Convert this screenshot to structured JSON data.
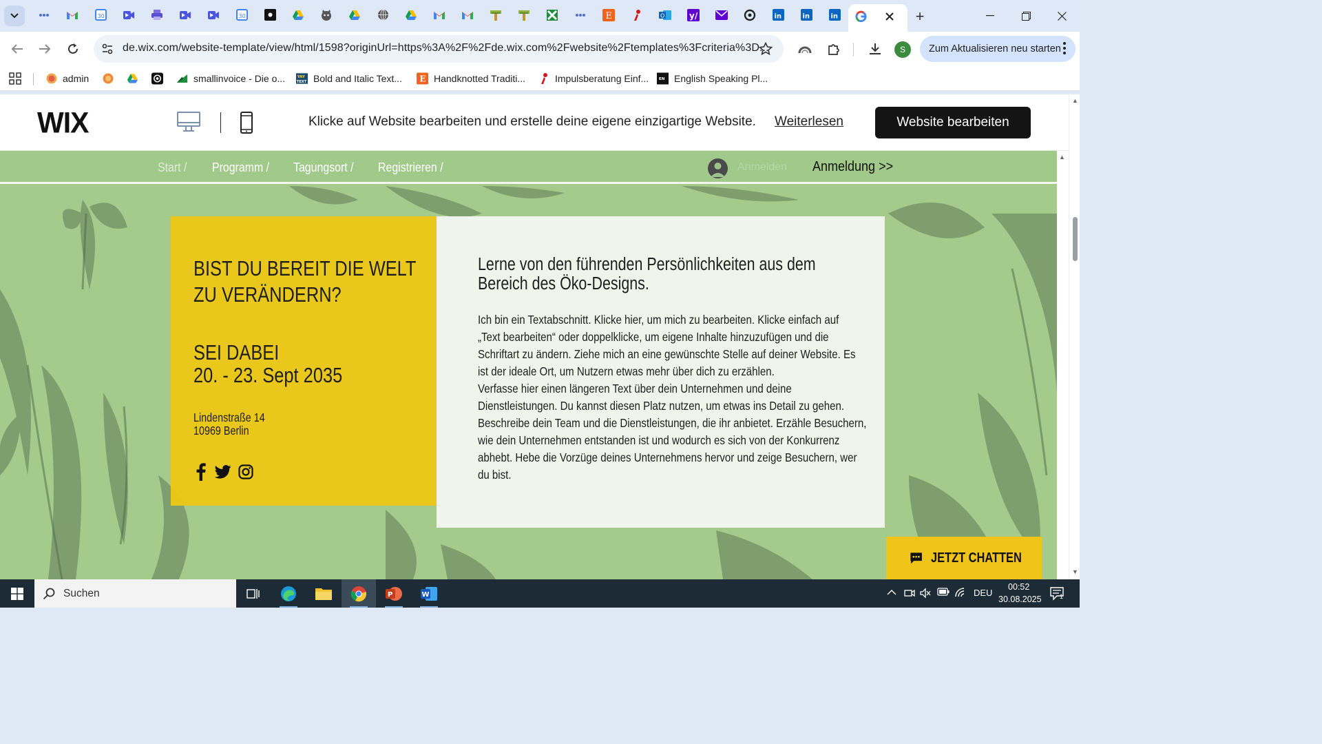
{
  "browser": {
    "tabs": [
      {
        "icon": "chat-tab-icon"
      },
      {
        "icon": "gmail-icon"
      },
      {
        "icon": "calendar-icon"
      },
      {
        "icon": "video-icon"
      },
      {
        "icon": "printer-icon"
      },
      {
        "icon": "video-icon"
      },
      {
        "icon": "video-icon"
      },
      {
        "icon": "calendar-icon"
      },
      {
        "icon": "notes-icon"
      },
      {
        "icon": "drive-icon"
      },
      {
        "icon": "cat-icon"
      },
      {
        "icon": "drive-icon"
      },
      {
        "icon": "globe-icon"
      },
      {
        "icon": "drive-icon"
      },
      {
        "icon": "gmail-icon"
      },
      {
        "icon": "gmail-icon"
      },
      {
        "icon": "tool-icon"
      },
      {
        "icon": "tool-icon"
      },
      {
        "icon": "puzzle-icon"
      },
      {
        "icon": "chat-tab-icon"
      },
      {
        "icon": "etsy-icon"
      },
      {
        "icon": "impuls-icon"
      },
      {
        "icon": "outlook-icon"
      },
      {
        "icon": "yahoo-icon"
      },
      {
        "icon": "mail-icon"
      },
      {
        "icon": "chatgpt-icon"
      },
      {
        "icon": "linkedin-icon"
      },
      {
        "icon": "linkedin-icon"
      },
      {
        "icon": "linkedin-icon"
      },
      {
        "icon": "google-icon"
      }
    ],
    "new_tab_symbol": "+",
    "url": "de.wix.com/website-template/view/html/1598?originUrl=https%3A%2F%2Fde.wix.com%2Fwebsite%2Ftemplates%3Fcriteria%3D...",
    "profile_initial": "S",
    "update_button": "Zum Aktualisieren neu starten",
    "bookmarks": [
      {
        "label": "admin",
        "icon": "admin-icon"
      },
      {
        "label": "",
        "icon": "orange-circle-icon"
      },
      {
        "label": "",
        "icon": "drive-icon"
      },
      {
        "label": "",
        "icon": "target-icon"
      },
      {
        "label": "smallinvoice - Die o...",
        "icon": "smallinvoice-icon"
      },
      {
        "label": "Bold and Italic Text...",
        "icon": "yaytext-icon"
      },
      {
        "label": "Handknotted Traditi...",
        "icon": "etsy-icon"
      },
      {
        "label": "Impulsberatung Einf...",
        "icon": "impuls-icon"
      },
      {
        "label": "English Speaking Pl...",
        "icon": "english-icon"
      }
    ]
  },
  "wix_bar": {
    "logo": "WIX",
    "promo_text": "Klicke auf Website bearbeiten und erstelle deine eigene einzigartige Website.",
    "read_more": "Weiterlesen",
    "edit_button": "Website bearbeiten"
  },
  "site": {
    "nav": [
      "Start /",
      "Programm /",
      "Tagungsort /",
      "Registrieren /"
    ],
    "login_ghost": "Anmelden",
    "anmeldung": "Anmeldung >>",
    "hero": {
      "title_lines": [
        "BIST DU BEREIT DIE WELT",
        "ZU VERÄNDERN?"
      ],
      "subtitle_lines": [
        "SEI DABEI",
        "20. - 23. Sept 2035"
      ],
      "address_lines": [
        "Lindenstraße 14",
        "10969 Berlin"
      ],
      "social": [
        "facebook-icon",
        "twitter-icon",
        "instagram-icon"
      ]
    },
    "info": {
      "title_lines": [
        "Lerne von den führenden Persönlichkeiten aus dem",
        "Bereich des Öko-Designs."
      ],
      "body_lines": [
        "Ich bin ein Textabschnitt. Klicke hier, um mich zu bearbeiten. Klicke einfach auf",
        "„Text bearbeiten“ oder doppelklicke, um eigene Inhalte hinzuzufügen und die",
        "Schriftart zu ändern. Ziehe mich an eine gewünschte Stelle auf deiner Website. Es",
        "ist der ideale Ort, um Nutzern etwas mehr über dich zu erzählen.",
        "Verfasse hier einen längeren Text über dein Unternehmen und deine",
        "Dienstleistungen. Du kannst diesen Platz nutzen, um etwas ins Detail zu gehen.",
        "Beschreibe dein Team und die Dienstleistungen, die ihr anbietet. Erzähle Besuchern,",
        "wie dein Unternehmen entstanden ist und wodurch es sich von der Konkurrenz",
        "abhebt. Hebe die Vorzüge deines Unternehmens hervor und zeige Besuchern, wer",
        "du bist."
      ]
    },
    "chat_button": "JETZT CHATTEN",
    "colors": {
      "green": "#a4cb8c",
      "yellow": "#ecc816",
      "panel": "#f3f5f0"
    }
  },
  "taskbar": {
    "search_placeholder": "Suchen",
    "apps": [
      "task-view-icon",
      "edge-icon",
      "file-explorer-icon",
      "chrome-icon",
      "powerpoint-icon",
      "word-icon"
    ],
    "language": "DEU",
    "time": "00:52",
    "date": "30.08.2025",
    "notification_count": "1"
  }
}
